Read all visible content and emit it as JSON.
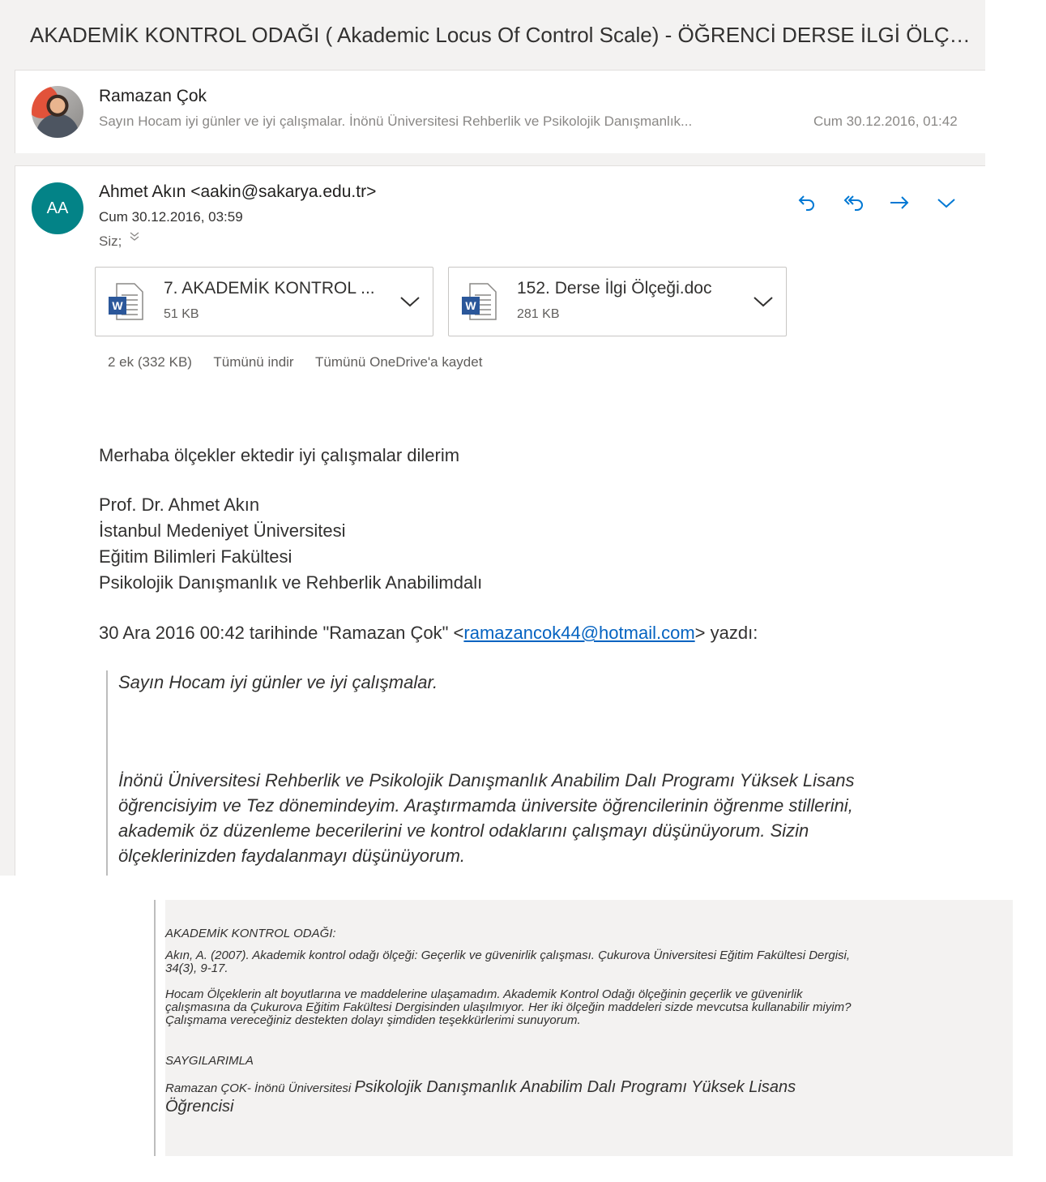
{
  "subject": "AKADEMİK KONTROL ODAĞI ( Akademic Locus Of Control Scale) - ÖĞRENCİ DERSE İLGİ ÖLÇEĞİ",
  "first_message": {
    "sender": "Ramazan Çok",
    "preview": "Sayın Hocam iyi günler ve iyi çalışmalar. İnönü Üniversitesi Rehberlik ve Psikolojik Danışmanlık...",
    "date": "Cum 30.12.2016, 01:42"
  },
  "reply": {
    "avatar_initials": "AA",
    "avatar_color": "#038387",
    "from": "Ahmet Akın <aakin@sakarya.edu.tr>",
    "date": "Cum 30.12.2016, 03:59",
    "to": "Siz;",
    "actions": [
      "reply-icon",
      "reply-all-icon",
      "forward-icon",
      "more-chevron-icon"
    ],
    "attachments": [
      {
        "name": "7. AKADEMİK KONTROL ...",
        "size": "51 KB"
      },
      {
        "name": "152. Derse İlgi Ölçeği.doc",
        "size": "281 KB"
      }
    ],
    "attachment_summary": "2 ek (332 KB)",
    "download_all": "Tümünü indir",
    "save_onedrive": "Tümünü OneDrive'a kaydet",
    "greeting": "Merhaba ölçekler ektedir iyi çalışmalar dilerim",
    "signature": [
      "Prof. Dr. Ahmet Akın",
      "İstanbul Medeniyet Üniversitesi",
      "Eğitim Bilimleri Fakültesi",
      "Psikolojik Danışmanlık ve Rehberlik Anabilimdalı"
    ],
    "quote_intro_before": "30 Ara 2016 00:42 tarihinde \"Ramazan Çok\" <",
    "quote_email": "ramazancok44@hotmail.com",
    "quote_intro_after": "> yazdı:",
    "quote_p1": "Sayın Hocam iyi günler ve iyi çalışmalar.",
    "quote_p2": "İnönü Üniversitesi Rehberlik ve Psikolojik Danışmanlık Anabilim Dalı Programı Yüksek Lisans öğrencisiyim ve Tez dönemindeyim. Araştırmamda üniversite öğrencilerinin öğrenme stillerini, akademik öz düzenleme becerilerini ve kontrol odaklarını çalışmayı düşünüyorum. Sizin ölçeklerinizden faydalanmayı düşünüyorum."
  },
  "lower_quote": {
    "heading": "AKADEMİK KONTROL ODAĞI:",
    "citation": "Akın, A. (2007). Akademik kontrol odağı ölçeği: Geçerlik ve güvenirlik çalışması. Çukurova Üniversitesi Eğitim Fakültesi Dergisi, 34(3), 9-17.",
    "request": "Hocam Ölçeklerin alt boyutlarına ve maddelerine ulaşamadım. Akademik Kontrol Odağı ölçeğinin geçerlik ve güvenirlik çalışmasına da Çukurova Eğitim Fakültesi Dergisinden ulaşılmıyor. Her iki ölçeğin maddeleri sizde mevcutsa  kullanabilir miyim? Çalışmama vereceğiniz destekten dolayı şimdiden teşekkürlerimi sunuyorum.",
    "closing": "SAYGILARIMLA",
    "sign_small": "Ramazan ÇOK- İnönü Üniversitesi",
    "sign_large": "Psikolojik Danışmanlık Anabilim Dalı Programı Yüksek Lisans Öğrencisi"
  }
}
